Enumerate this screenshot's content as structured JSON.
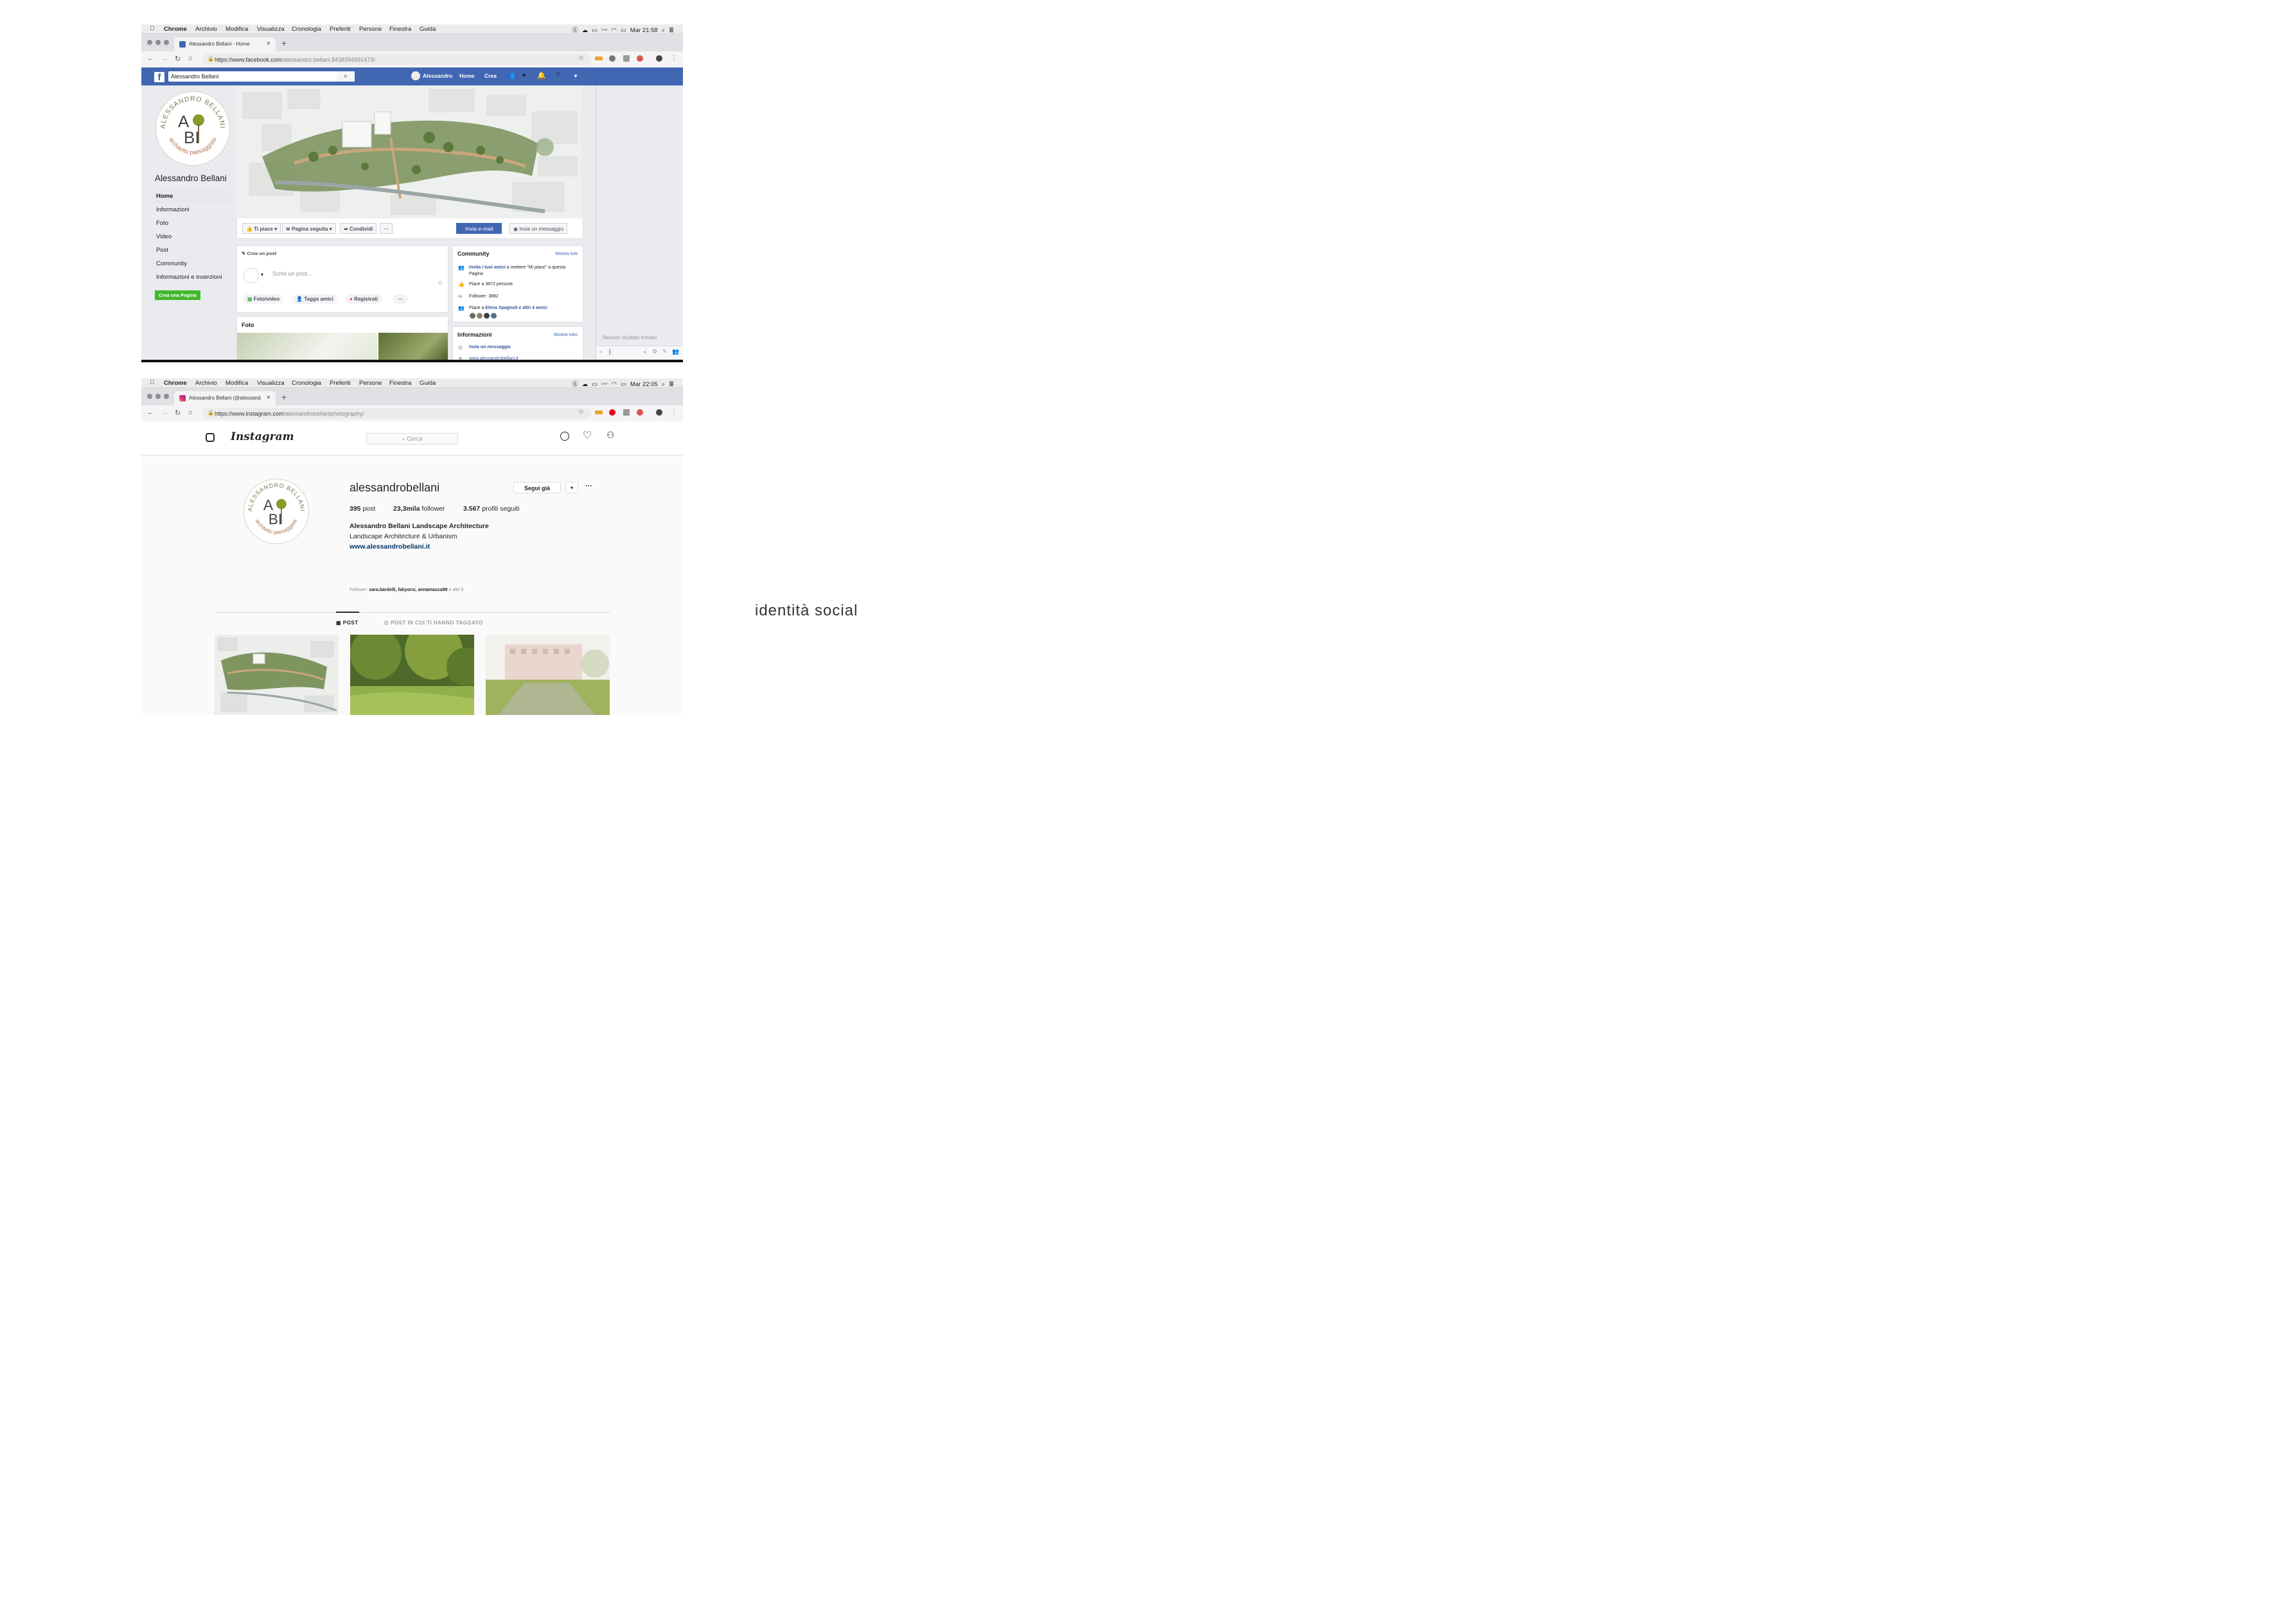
{
  "facebook": {
    "menubar": {
      "apple": "",
      "items": [
        "Chrome",
        "Archivio",
        "Modifica",
        "Visualizza",
        "Cronologia",
        "Preferiti",
        "Persone",
        "Finestra",
        "Guida"
      ],
      "clock": "Mar 21:58"
    },
    "tab_title": "Alessandro Bellani - Home",
    "url_host": "https://www.facebook.com",
    "url_path": "/alessandro.bellani.8438394891473/",
    "search_value": "Alessandro Bellani",
    "nav": {
      "user": "Alessandro",
      "home": "Home",
      "create": "Crea"
    },
    "page_name": "Alessandro Bellani",
    "sidebar": [
      "Home",
      "Informazioni",
      "Foto",
      "Video",
      "Post",
      "Community",
      "Informazioni e inserzioni"
    ],
    "create_page_button": "Crea una Pagina",
    "actions": {
      "like": "Ti piace",
      "follow": "Pagina seguita",
      "share": "Condividi",
      "more": "···",
      "email": "Invia e-mail",
      "message": "Invia un messaggio"
    },
    "composer": {
      "title": "Crea un post",
      "placeholder": "Scrivi un post...",
      "photo": "Foto/video",
      "tag": "Tagga amici",
      "checkin": "Registrati",
      "more": "···"
    },
    "photos_title": "Foto",
    "community": {
      "title": "Community",
      "see_all": "Mostra tutti",
      "invite_link": "Invita i tuoi amici",
      "invite_rest": " a mettere \"Mi piace\" a questa Pagina",
      "likes": "Piace a 3872 persone",
      "followers": "Follower: 3882",
      "liked_by_prefix": "Piace a ",
      "liked_by_names": "Elena Spagnoli e altri 4 amici"
    },
    "info": {
      "title": "Informazioni",
      "see_all": "Mostra tutto",
      "message": "Invia un messaggio",
      "website": "www.alessandrobellani.it"
    },
    "chat": {
      "empty": "Nessun risultato trovato"
    }
  },
  "instagram": {
    "menubar": {
      "items": [
        "Chrome",
        "Archivio",
        "Modifica",
        "Visualizza",
        "Cronologia",
        "Preferiti",
        "Persone",
        "Finestra",
        "Guida"
      ],
      "clock": "Mar 22:05"
    },
    "tab_title": "Alessandro Bellani (@alessandr",
    "url_host": "https://www.instagram.com",
    "url_path": "/alessandrobellaniphotography/",
    "wordmark": "Instagram",
    "search_placeholder": "Cerca",
    "username": "alessandrobellani",
    "follow_button": "Segui già",
    "dropdown": "▾",
    "more": "···",
    "stats": [
      {
        "num": "395",
        "label": " post"
      },
      {
        "num": "23,3mila",
        "label": " follower"
      },
      {
        "num": "3.567",
        "label": " profili seguiti"
      }
    ],
    "bio_name": "Alessandro Bellani Landscape Architecture",
    "bio_line": "Landscape Architecture & Urbanism",
    "bio_link": "www.alessandrobellani.it",
    "followed_by_prefix": "Follower: ",
    "followed_by_names": "sara.bardelli, fabyorsi, annamasca99",
    "followed_by_suffix": " e altri 5",
    "tabs": {
      "posts": "POST",
      "tagged": "POST IN CUI TI HANNO TAGGATO"
    }
  },
  "logo": {
    "top": "ALESSANDRO BELLANI",
    "bottom": "architetto paesaggista",
    "a": "A",
    "bi": "BI"
  },
  "caption": "identità social",
  "colors": {
    "facebook_blue": "#4267b2",
    "green_button": "#42b72a",
    "logo_green": "#8a9a2b",
    "logo_brown": "#b07d5b"
  }
}
